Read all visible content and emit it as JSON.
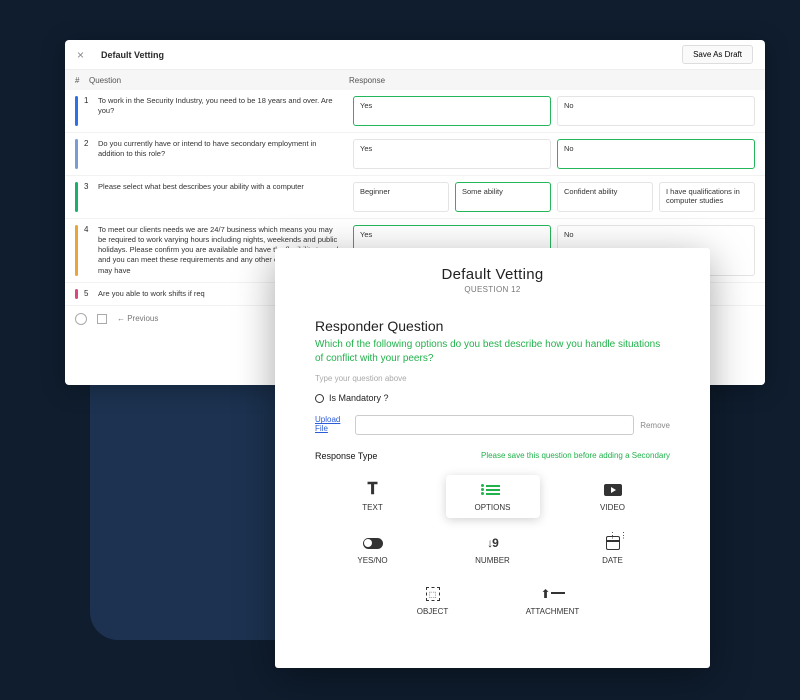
{
  "back": {
    "title": "Default Vetting",
    "save_btn": "Save As Draft",
    "headers": {
      "num": "#",
      "question": "Question",
      "response": "Response"
    },
    "rows": [
      {
        "n": "1",
        "q": "To work in the Security Industry, you need to be 18 years and over. Are you?",
        "opts": [
          "Yes",
          "No"
        ],
        "sel": 0
      },
      {
        "n": "2",
        "q": "Do you currently have or intend to have secondary employment in addition to this role?",
        "opts": [
          "Yes",
          "No"
        ],
        "sel": 1
      },
      {
        "n": "3",
        "q": "Please select what best describes your ability with a computer",
        "opts": [
          "Beginner",
          "Some ability",
          "Confident ability",
          "I have qualifications in computer studies"
        ],
        "sel": 1
      },
      {
        "n": "4",
        "q": "To meet our clients needs we are 24/7 business which means you may be required to work varying hours including nights, weekends and public holidays. Please confirm you are available and have the flexibility to work and you can meet these requirements and any other commitments you may have",
        "opts": [
          "Yes",
          "No"
        ],
        "sel": 0
      },
      {
        "n": "5",
        "q": "Are you able to work shifts if req",
        "opts": [],
        "sel": -1
      }
    ],
    "footer_prev": "← Previous"
  },
  "front": {
    "title": "Default Vetting",
    "subtitle": "QUESTION 12",
    "section": "Responder Question",
    "question_text": "Which of the following options do you best describe how you handle situations of conflict with your peers?",
    "hint": "Type your question above",
    "mandatory_label": "Is Mandatory ?",
    "upload_label": "Upload File",
    "remove_label": "Remove",
    "response_type_label": "Response Type",
    "warning": "Please save this question before adding a Secondary",
    "types": {
      "text": "TEXT",
      "options": "OPTIONS",
      "video": "VIDEO",
      "yesno": "YES/NO",
      "number": "NUMBER",
      "date": "DATE",
      "object": "OBJECT",
      "attachment": "ATTACHMENT"
    }
  }
}
